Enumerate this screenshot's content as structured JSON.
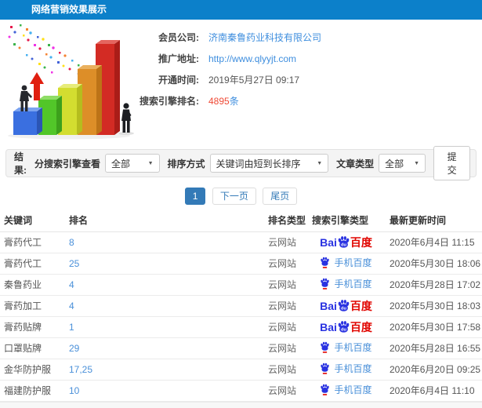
{
  "header": {
    "title": "网络营销效果展示"
  },
  "info": {
    "rows": [
      {
        "label": "会员公司:",
        "value": "济南秦鲁药业科技有限公司"
      },
      {
        "label": "推广地址:",
        "value": "http://www.qlyyjt.com"
      },
      {
        "label": "开通时间:",
        "value": "2019年5月27日 09:17"
      },
      {
        "label": "搜索引擎排名:",
        "count": "4895",
        "unit": "条"
      }
    ]
  },
  "filters": {
    "result_label": "结果:",
    "engine_label": "分搜索引擎查看",
    "engine_value": "全部",
    "sort_label": "排序方式",
    "sort_value": "关键词由短到长排序",
    "type_label": "文章类型",
    "type_value": "全部",
    "submit_label": "提交"
  },
  "pagination": {
    "current": "1",
    "next": "下一页",
    "last": "尾页"
  },
  "table": {
    "headers": [
      "关键词",
      "排名",
      "排名类型",
      "搜索引擎类型",
      "最新更新时间"
    ],
    "engine_labels": {
      "bai": "Bai",
      "du": "du",
      "cn": "百度",
      "mobile": "手机百度"
    },
    "rows": [
      {
        "keyword": "膏药代工",
        "rank": "8",
        "rank_type": "云网站",
        "engine": "baidu",
        "time": "2020年6月4日 11:15"
      },
      {
        "keyword": "膏药代工",
        "rank": "25",
        "rank_type": "云网站",
        "engine": "mobile",
        "time": "2020年5月30日 18:06"
      },
      {
        "keyword": "秦鲁药业",
        "rank": "4",
        "rank_type": "云网站",
        "engine": "mobile",
        "time": "2020年5月28日 17:02"
      },
      {
        "keyword": "膏药加工",
        "rank": "4",
        "rank_type": "云网站",
        "engine": "baidu",
        "time": "2020年5月30日 18:03"
      },
      {
        "keyword": "膏药贴牌",
        "rank": "1",
        "rank_type": "云网站",
        "engine": "baidu",
        "time": "2020年5月30日 17:58"
      },
      {
        "keyword": "口罩贴牌",
        "rank": "29",
        "rank_type": "云网站",
        "engine": "mobile",
        "time": "2020年5月28日 16:55"
      },
      {
        "keyword": "金华防护服",
        "rank": "17,25",
        "rank_type": "云网站",
        "engine": "mobile",
        "time": "2020年6月20日 09:25"
      },
      {
        "keyword": "福建防护服",
        "rank": "10",
        "rank_type": "云网站",
        "engine": "mobile",
        "time": "2020年6月4日 11:10"
      }
    ]
  },
  "colors": {
    "header_bg": "#0c80ca",
    "link_blue": "#3e8ede",
    "count_red": "#ef4a36",
    "active_page": "#337ab7",
    "baidu_blue": "#2932e1",
    "baidu_red": "#e10601"
  }
}
